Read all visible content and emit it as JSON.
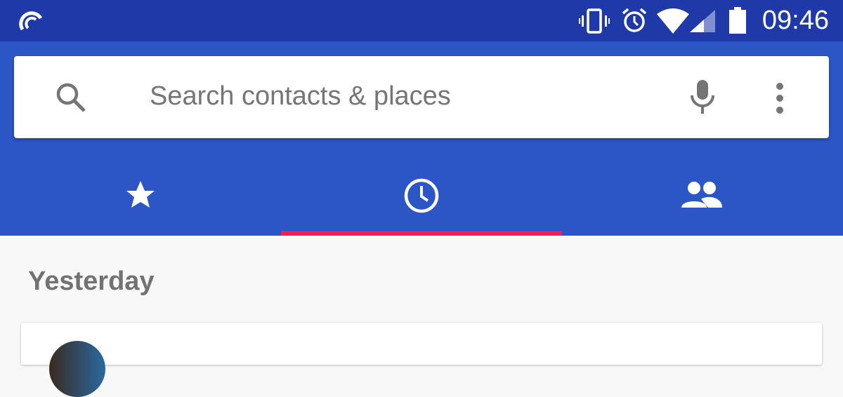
{
  "status_bar": {
    "time": "09:46",
    "icons": [
      "app-notification-icon",
      "vibrate-icon",
      "alarm-icon",
      "wifi-icon",
      "signal-icon",
      "battery-icon"
    ]
  },
  "search": {
    "placeholder": "Search contacts & places",
    "icons": [
      "search-icon",
      "mic-icon",
      "more-vert-icon"
    ]
  },
  "tabs": [
    {
      "name": "favorites",
      "icon": "star-icon",
      "selected": false
    },
    {
      "name": "recents",
      "icon": "clock-icon",
      "selected": true
    },
    {
      "name": "contacts",
      "icon": "people-icon",
      "selected": false
    }
  ],
  "colors": {
    "status_bar": "#1f3aa8",
    "app_bar": "#2c56c6",
    "tab_indicator": "#e91e63"
  },
  "list": {
    "section_header": "Yesterday"
  }
}
